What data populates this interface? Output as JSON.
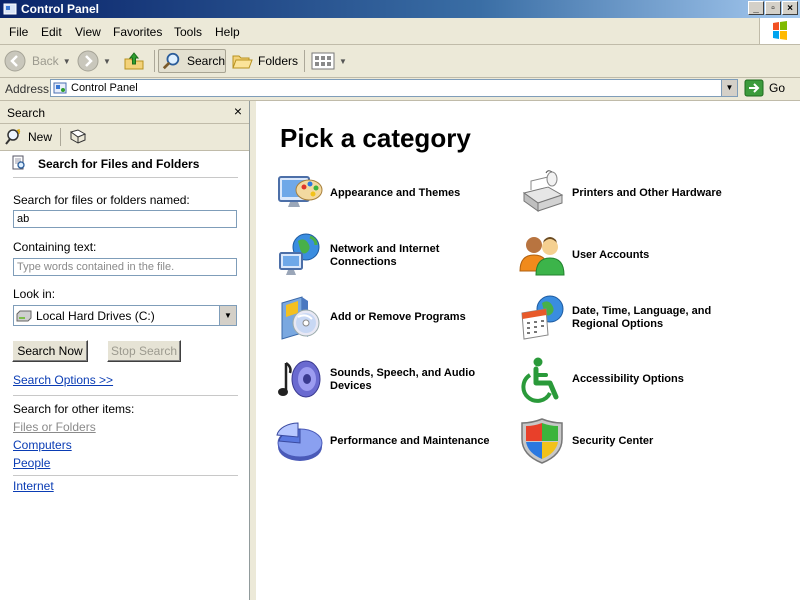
{
  "window": {
    "title": "Control Panel"
  },
  "menu": {
    "items": [
      "File",
      "Edit",
      "View",
      "Favorites",
      "Tools",
      "Help"
    ]
  },
  "toolbar": {
    "back": "Back",
    "search": "Search",
    "folders": "Folders"
  },
  "address": {
    "label": "Address",
    "value": "Control Panel",
    "go": "Go"
  },
  "search_pane": {
    "title": "Search",
    "new": "New",
    "heading": "Search for Files and Folders",
    "name_label": "Search for files or folders named:",
    "name_value": "ab",
    "containing_label": "Containing text:",
    "containing_placeholder": "Type words contained in the file.",
    "lookin_label": "Look in:",
    "lookin_value": "Local Hard Drives (C:)",
    "search_now": "Search Now",
    "stop_search": "Stop Search",
    "search_options": "Search Options  >>",
    "other_label": "Search for other items:",
    "other_items": [
      "Files or Folders",
      "Computers",
      "People"
    ],
    "internet": "Internet"
  },
  "main": {
    "title": "Pick a category",
    "categories": [
      {
        "label1": "Appearance and Themes",
        "label2": "",
        "icon": "appearance-icon"
      },
      {
        "label1": "Printers and Other Hardware",
        "label2": "",
        "icon": "printer-icon"
      },
      {
        "label1": "Network and Internet",
        "label2": "Connections",
        "icon": "network-icon"
      },
      {
        "label1": "User Accounts",
        "label2": "",
        "icon": "users-icon"
      },
      {
        "label1": "Add or Remove Programs",
        "label2": "",
        "icon": "programs-icon"
      },
      {
        "label1": "Date, Time, Language, and",
        "label2": "Regional Options",
        "icon": "datetime-icon"
      },
      {
        "label1": "Sounds, Speech, and Audio",
        "label2": "Devices",
        "icon": "sound-icon"
      },
      {
        "label1": "Accessibility Options",
        "label2": "",
        "icon": "accessibility-icon"
      },
      {
        "label1": "Performance and Maintenance",
        "label2": "",
        "icon": "performance-icon"
      },
      {
        "label1": "Security Center",
        "label2": "",
        "icon": "security-icon"
      }
    ]
  }
}
